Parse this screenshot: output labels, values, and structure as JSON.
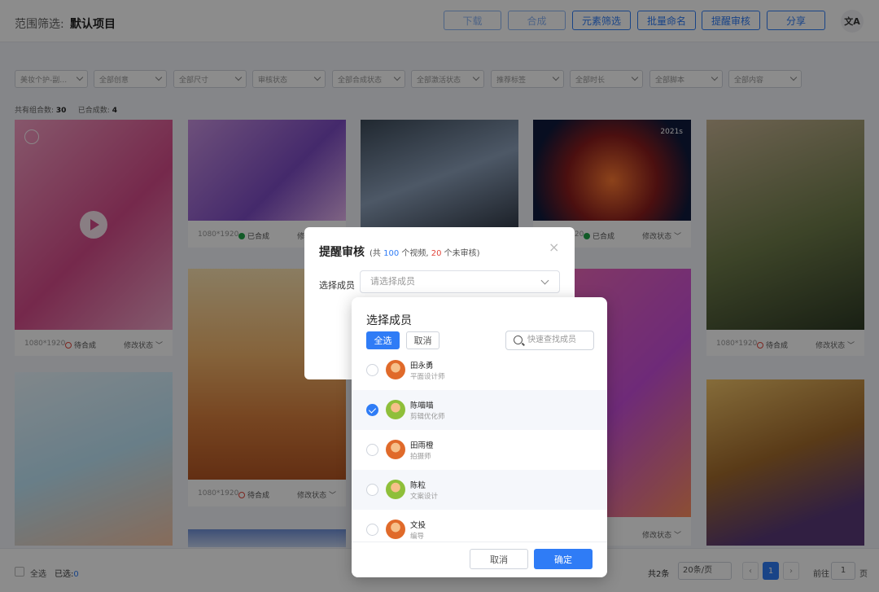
{
  "header": {
    "scope_label": "范围筛选:",
    "scope_value": "默认项目",
    "buttons": [
      "下载",
      "合成",
      "元素筛选",
      "批量命名",
      "提醒审核",
      "分享"
    ],
    "lang_icon": "translate-icon"
  },
  "filters": [
    "美妆个护-副…",
    "全部创意",
    "全部尺寸",
    "审核状态",
    "全部合成状态",
    "全部激活状态",
    "推荐标签",
    "全部时长",
    "全部脚本",
    "全部内容"
  ],
  "stats": {
    "combo_label": "共有组合数:",
    "combo_count": "30",
    "done_label": "已合成数:",
    "done_count": "4"
  },
  "cards": [
    {
      "size": "1080*1920",
      "state": "待合成",
      "modify": "修改状态 ﹀"
    },
    {
      "size": "1080*1920",
      "state": "已合成",
      "modify": "修改状态 ﹀"
    },
    {
      "size": "1080*1920",
      "state": "已合成",
      "modify": "修改状态 ﹀",
      "duration": "2021s"
    },
    {
      "size": "1080*1920",
      "state": "待合成",
      "modify": "修改状态 ﹀"
    },
    {
      "size": "1080*1920",
      "state": "待合成",
      "modify": "修改状态 ﹀"
    },
    {
      "modify": "修改状态 ﹀"
    }
  ],
  "bottom": {
    "select_all": "全选",
    "selected_label": "已选:",
    "selected_count": "0",
    "total": "共2条",
    "page_size": "20条/页",
    "current_page": "1",
    "goto_label": "前往",
    "goto_value": "1",
    "goto_unit": "页"
  },
  "remind_dialog": {
    "title": "提醒审核",
    "summary_prefix": "(共",
    "video_count": "100",
    "summary_mid": "个视频,",
    "unreviewed_count": "20",
    "summary_suffix": "个未审核)",
    "close": "×",
    "field_label": "选择成员",
    "select_placeholder": "请选择成员"
  },
  "member_panel": {
    "title": "选择成员",
    "select_all": "全选",
    "cancel": "取消",
    "search_placeholder": "快速查找成员",
    "members": [
      {
        "name": "田永勇",
        "role": "平面设计师",
        "checked": false
      },
      {
        "name": "陈喵喵",
        "role": "剪辑优化师",
        "checked": true
      },
      {
        "name": "田雨橙",
        "role": "拍摄师",
        "checked": false
      },
      {
        "name": "陈粒",
        "role": "文案设计",
        "checked": false
      },
      {
        "name": "文投",
        "role": "编导",
        "checked": false
      }
    ],
    "footer_cancel": "取消",
    "footer_ok": "确定"
  },
  "colors": {
    "primary": "#2f7cf6",
    "danger": "#e2453b",
    "success": "#1fa548"
  }
}
